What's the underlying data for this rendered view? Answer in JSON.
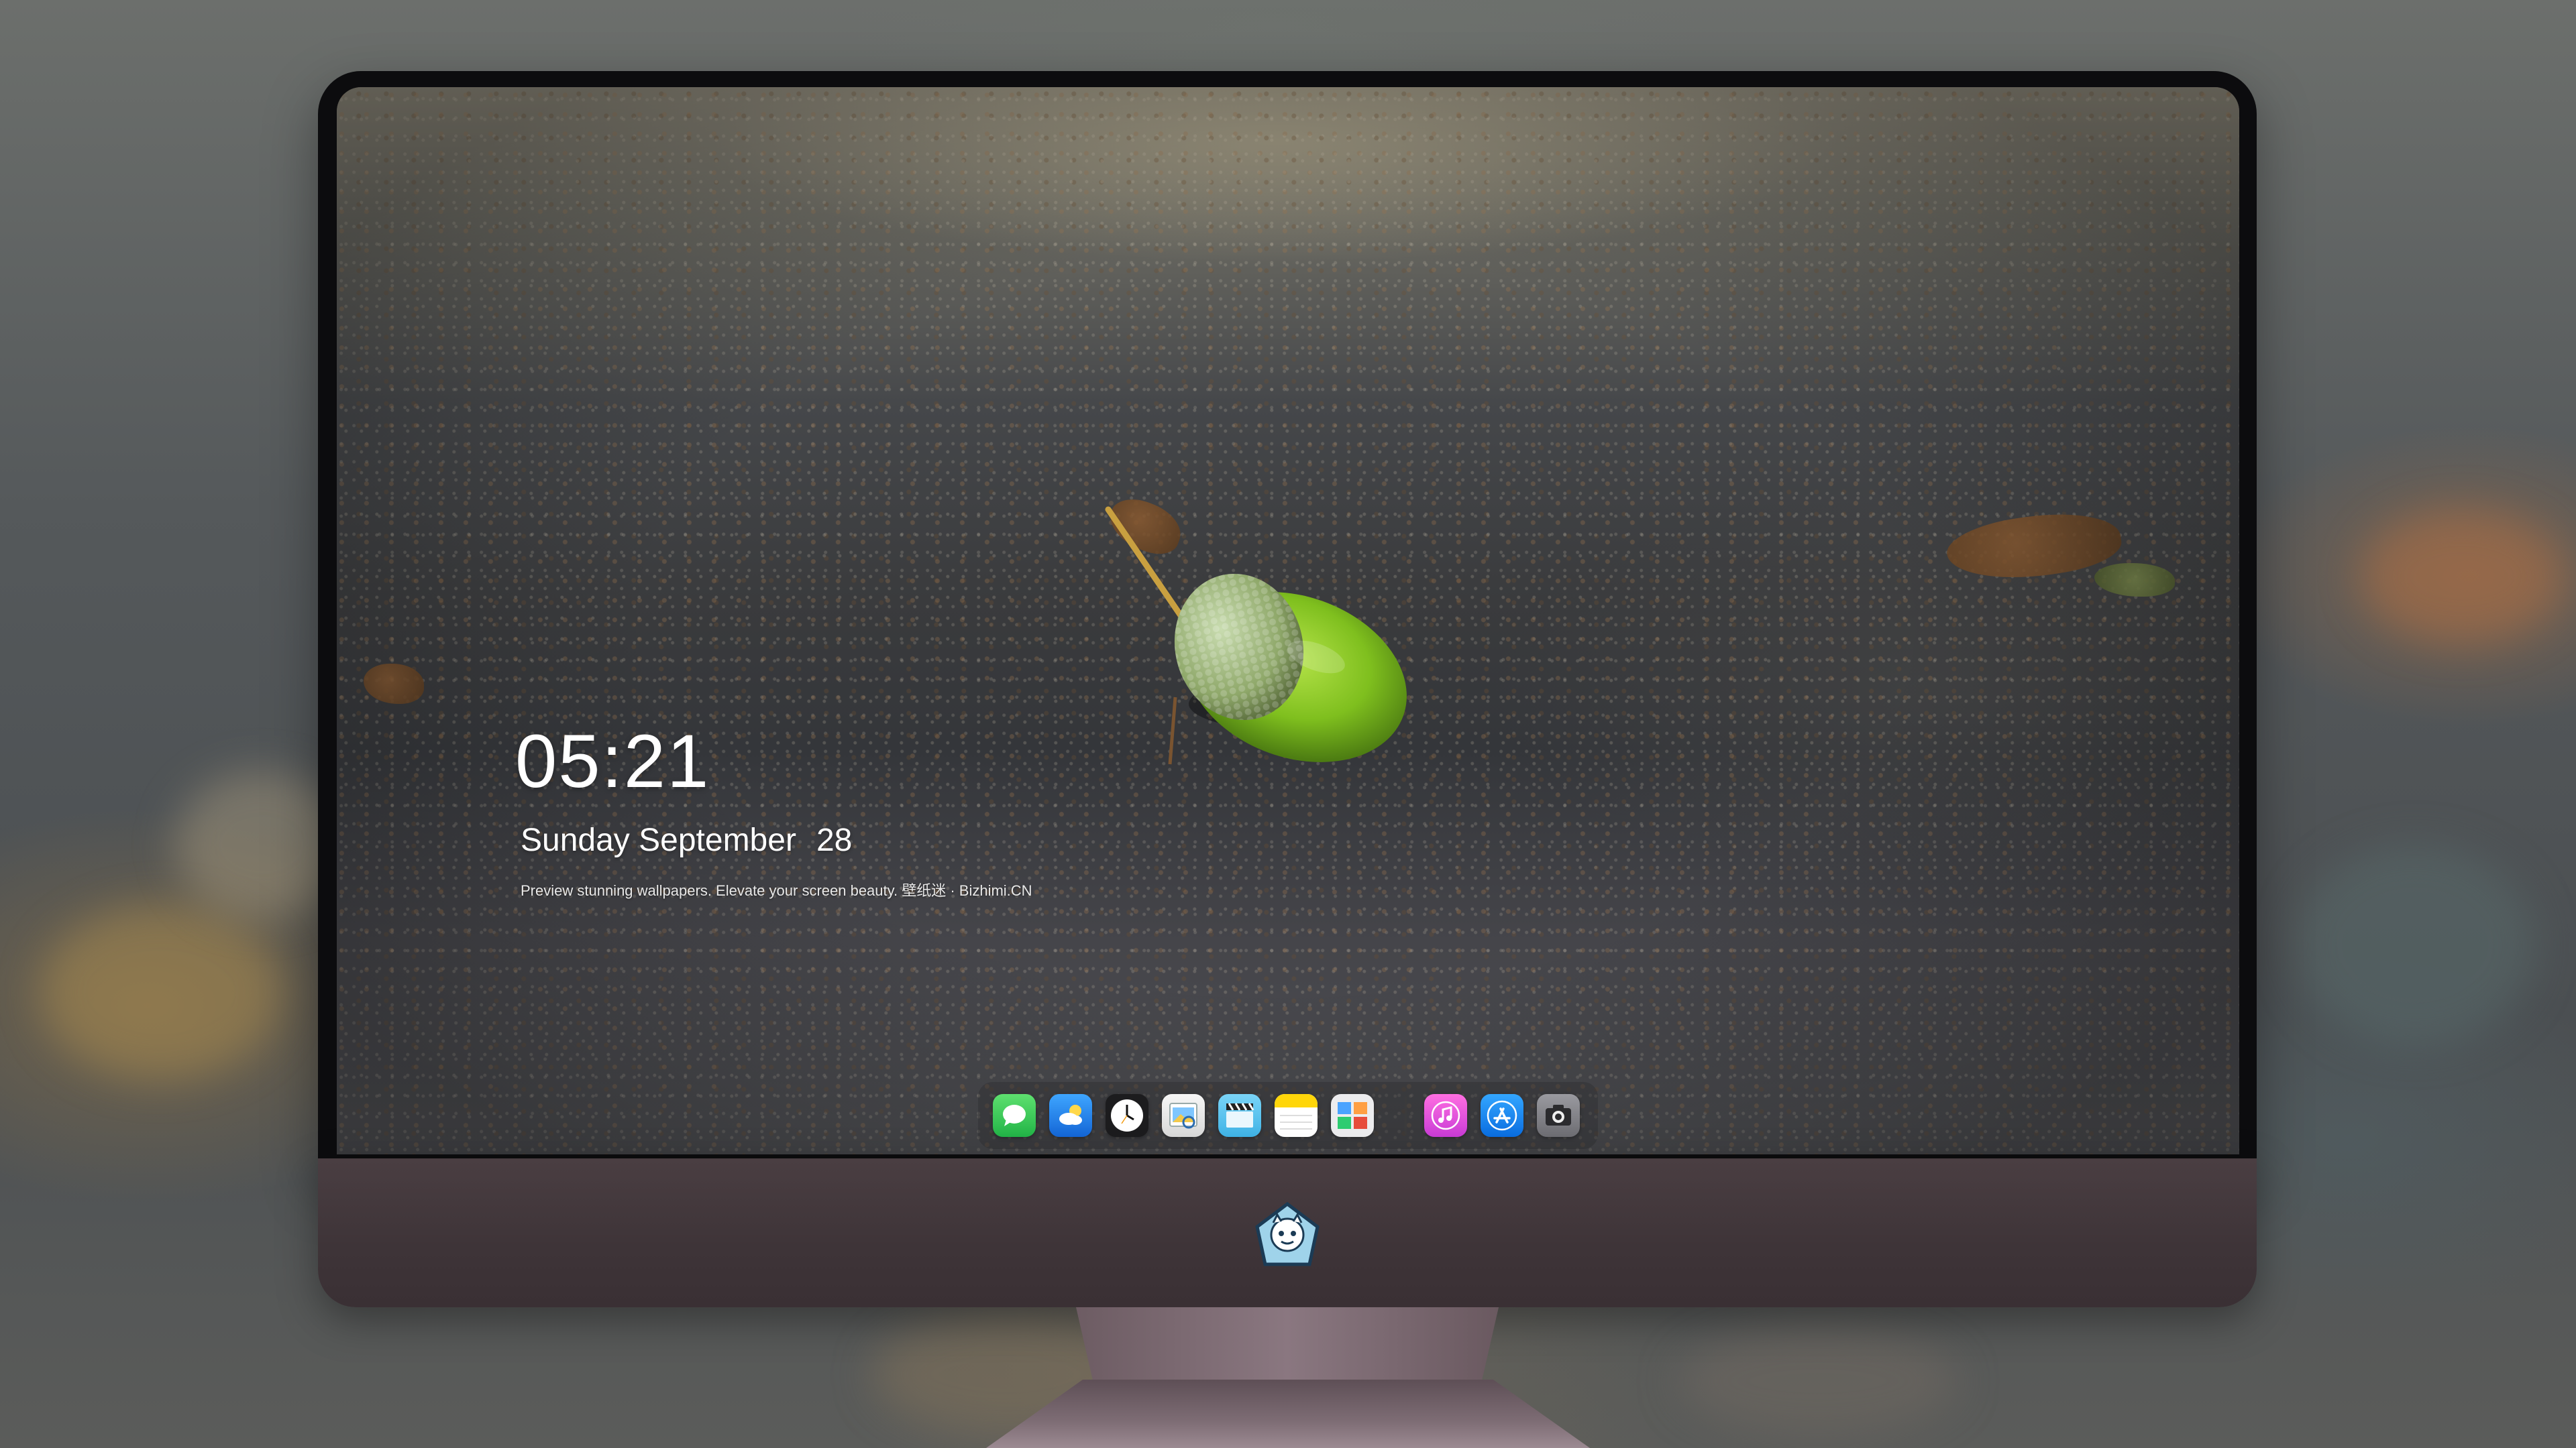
{
  "lockscreen": {
    "time": "05:21",
    "weekday_month": "Sunday September",
    "day": "28",
    "tagline": "Preview stunning wallpapers. Elevate your screen beauty. 壁纸迷 · Bizhimi.CN"
  },
  "dock": {
    "apps": [
      {
        "name": "messages",
        "icon": "messages-icon",
        "color": "#34c759"
      },
      {
        "name": "weather",
        "icon": "weather-icon",
        "color": "#2f8cf0"
      },
      {
        "name": "clock",
        "icon": "clock-icon",
        "color": "#1c1c1e"
      },
      {
        "name": "preview",
        "icon": "preview-icon",
        "color": "#f2c94c"
      },
      {
        "name": "clips",
        "icon": "clapperboard-icon",
        "color": "#5ac8fa"
      },
      {
        "name": "notes",
        "icon": "notes-icon",
        "color": "#ffd60a"
      },
      {
        "name": "photo-gallery",
        "icon": "photo-gallery-icon",
        "color": "#e9e9ea"
      },
      {
        "name": "music",
        "icon": "music-icon",
        "color": "#ff4fd8"
      },
      {
        "name": "app-store",
        "icon": "app-store-icon",
        "color": "#1a8cff"
      },
      {
        "name": "camera",
        "icon": "camera-icon",
        "color": "#8e8e93"
      }
    ]
  },
  "colors": {
    "chin": "#3e3438",
    "bezel": "#0c0c0e",
    "text": "#ffffff"
  }
}
